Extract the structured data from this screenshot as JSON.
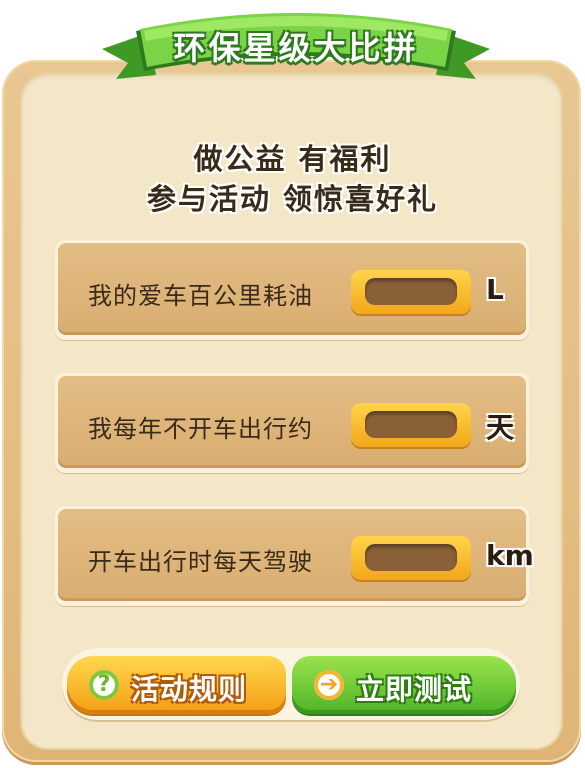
{
  "header": {
    "title": "环保星级大比拼"
  },
  "slogan": {
    "line1": "做公益 有福利",
    "line2": "参与活动 领惊喜好礼"
  },
  "rows": [
    {
      "label": "我的爱车百公里耗油",
      "unit": "L",
      "value": ""
    },
    {
      "label": "我每年不开车出行约",
      "unit": "天",
      "value": ""
    },
    {
      "label": "开车出行时每天驾驶",
      "unit": "km",
      "value": ""
    }
  ],
  "buttons": {
    "rules_label": "活动规则",
    "test_label": "立即测试",
    "rules_icon": "?",
    "test_icon": "➔"
  },
  "colors": {
    "ribbon_green": "#6cc63a",
    "board": "#e4bd82",
    "input_orange": "#f7b32b",
    "button_orange": "#f8a91c",
    "button_green": "#5fbf2c"
  }
}
